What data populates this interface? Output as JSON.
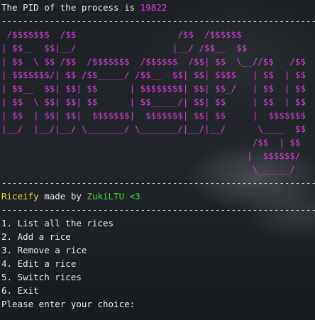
{
  "header": {
    "pid_prefix": "The PID of the process is ",
    "pid_value": "19822"
  },
  "separator": "-----------------------------------------------------------",
  "banner": {
    "ascii_art": " /$$$$$$$  /$$                   /$$  /$$$$$$\n| $$__  $$|__/                  |__/ /$$__  $$\n| $$  \\ $$ /$$  /$$$$$$$  /$$$$$$  /$$| $$  \\__//$$   /$$\n| $$$$$$$/| $$ /$$_____/ /$$__  $$| $$| $$$$   | $$  | $$\n| $$__  $$| $$| $$      | $$$$$$$$| $$| $$_/   | $$  | $$\n| $$  \\ $$| $$| $$      | $$_____/| $$| $$     | $$  | $$\n| $$  | $$| $$|  $$$$$$$|  $$$$$$$| $$| $$     |  $$$$$$$\n|__/  |__/|__/ \\_______/ \\_______/|__/|__/      \\____  $$\n                                               /$$  | $$\n                                              |  $$$$$$/\n                                               \\______/"
  },
  "credits": {
    "app_name": "Riceify",
    "made_by": " made by ",
    "author": "ZukiLTU <3"
  },
  "menu": {
    "items": [
      "1. List all the rices",
      "2. Add a rice",
      "3. Remove a rice",
      "4. Edit a rice",
      "5. Switch rices",
      "6. Exit"
    ],
    "prompt": "Please enter your choice: "
  },
  "colors": {
    "accent_magenta": "#d33dd3",
    "app_name_yellow": "#e6d23c",
    "author_green": "#3ed63e",
    "text": "#e6e6e6"
  }
}
